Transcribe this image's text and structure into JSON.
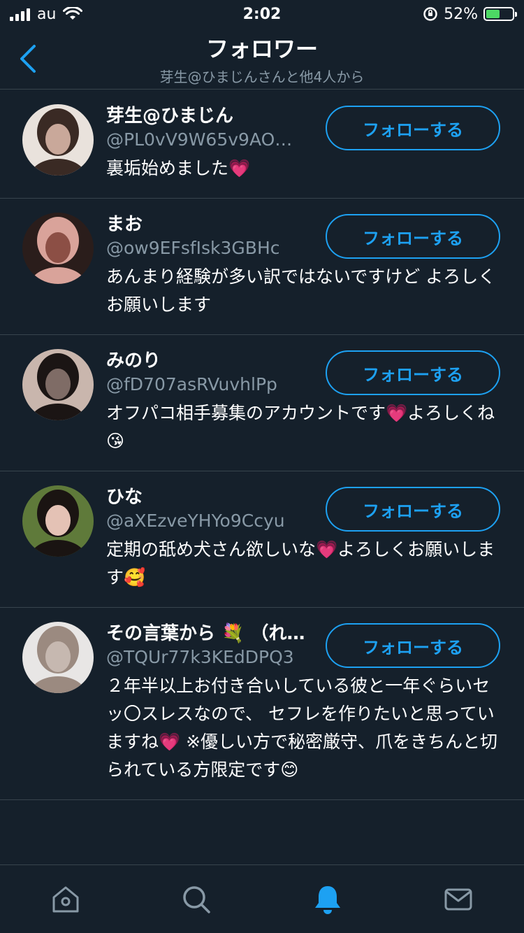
{
  "status_bar": {
    "carrier": "au",
    "time": "2:02",
    "battery_percent": "52%",
    "battery_level": 0.52
  },
  "header": {
    "title": "フォロワー",
    "subtitle": "芽生@ひまじんさんと他4人から"
  },
  "followers": [
    {
      "name": "芽生@ひまじん",
      "handle": "@PL0vV9W65v9AO…",
      "bio": "裏垢始めました💗",
      "button": "フォローする",
      "avatar_colors": [
        "#e9e2dc",
        "#3a2a24",
        "#c9a89a"
      ]
    },
    {
      "name": "まお",
      "handle": "@ow9EFsfIsk3GBHc",
      "bio": "あんまり経験が多い訳ではないですけど よろしくお願いします",
      "button": "フォローする",
      "avatar_colors": [
        "#2a1d1b",
        "#d9a39a",
        "#8c4f45"
      ]
    },
    {
      "name": "みのり",
      "handle": "@fD707asRVuvhlPp",
      "bio": "オフパコ相手募集のアカウントです💗よろしくね😘",
      "button": "フォローする",
      "avatar_colors": [
        "#c9b6ad",
        "#1b1514",
        "#7f6c66"
      ]
    },
    {
      "name": "ひな",
      "handle": "@aXEzveYHYo9Ccyu",
      "bio": "定期の舐め犬さん欲しいな💗よろしくお願いします🥰",
      "button": "フォローする",
      "avatar_colors": [
        "#5f7a3a",
        "#1a1412",
        "#e4c2b5"
      ]
    },
    {
      "name": "その言葉から 💐 （れ…",
      "handle": "@TQUr77k3KEdDPQ3",
      "bio": "２年半以上お付き合いしている彼と一年ぐらいセッ〇スレスなので、 セフレを作りたいと思っていますね💗 ※優しい方で秘密厳守、爪をきちんと切られている方限定です😊",
      "button": "フォローする",
      "avatar_colors": [
        "#e8e6e5",
        "#9b8a80",
        "#c6b8b0"
      ]
    }
  ],
  "tab_bar": {
    "tabs": [
      {
        "icon": "home-icon",
        "active": false
      },
      {
        "icon": "search-icon",
        "active": false
      },
      {
        "icon": "bell-icon",
        "active": true
      },
      {
        "icon": "mail-icon",
        "active": false
      }
    ],
    "accent": "#1da1f2",
    "inactive": "#8899a6"
  }
}
